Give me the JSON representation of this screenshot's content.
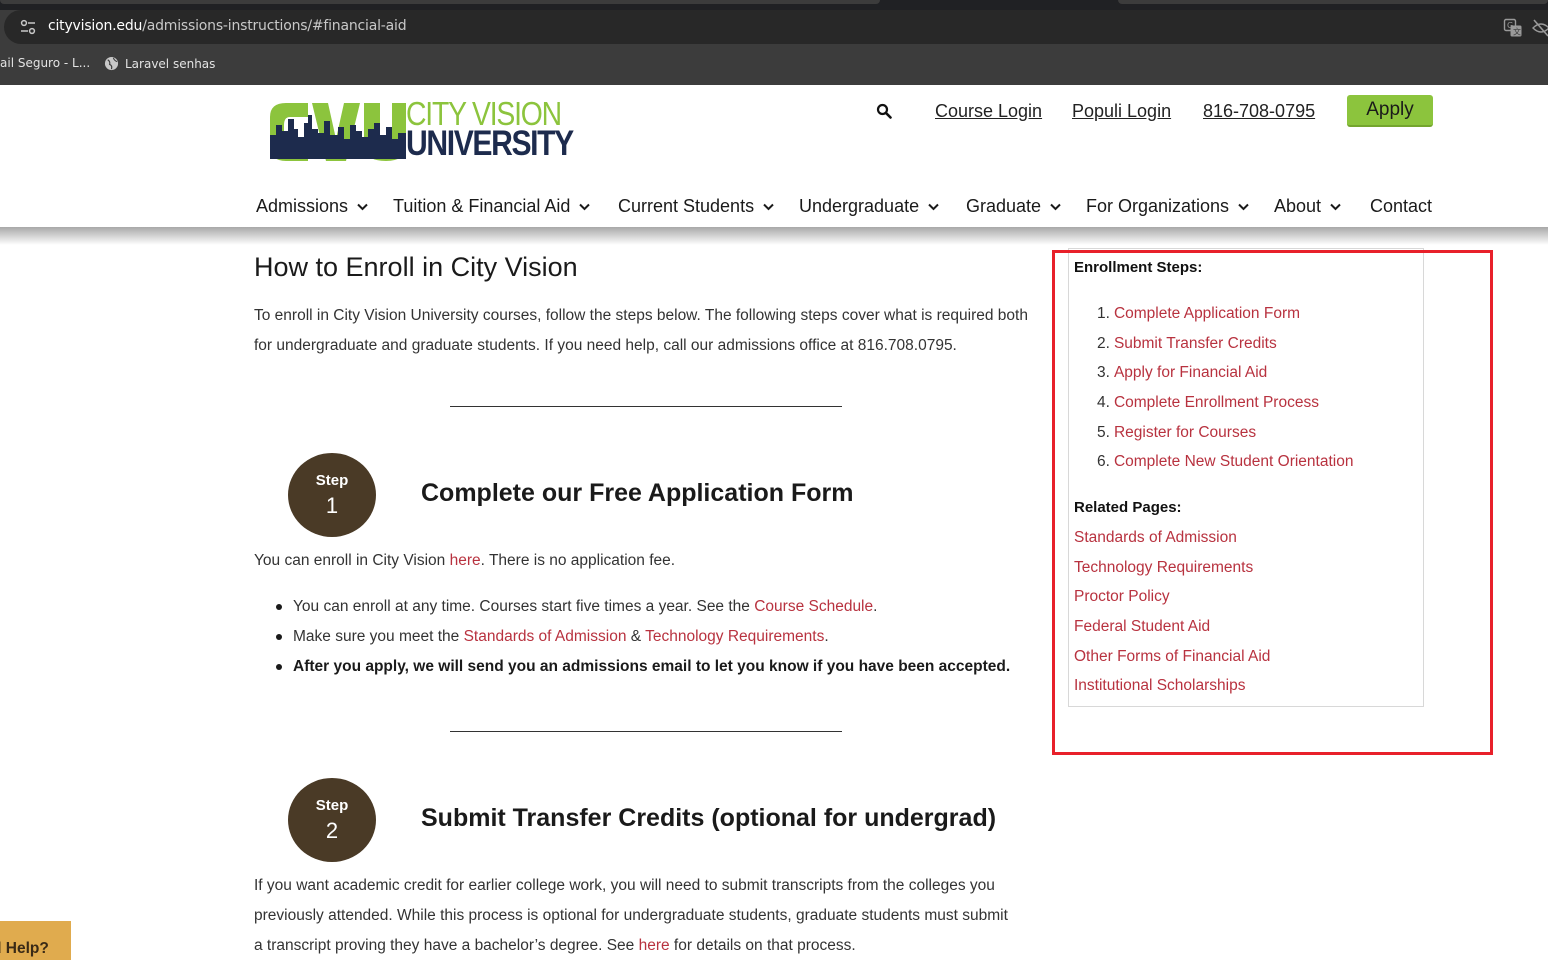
{
  "browser": {
    "url_host": "cityvision.edu",
    "url_path": "/admissions-instructions/#financial-aid",
    "bookmarks": [
      {
        "label": "ail Seguro - L..."
      },
      {
        "label": "Laravel senhas"
      }
    ]
  },
  "logo": {
    "line1": "CITY VISION",
    "line2": "UNIVERSITY",
    "brand_green": "#8cc43d",
    "brand_navy": "#1d2b4d"
  },
  "header": {
    "course_login": "Course Login",
    "populi_login": "Populi Login",
    "phone": "816-708-0795",
    "apply": "Apply"
  },
  "nav": [
    {
      "label": "Admissions",
      "has_dropdown": true
    },
    {
      "label": "Tuition & Financial Aid",
      "has_dropdown": true
    },
    {
      "label": "Current Students",
      "has_dropdown": true
    },
    {
      "label": "Undergraduate",
      "has_dropdown": true
    },
    {
      "label": "Graduate",
      "has_dropdown": true
    },
    {
      "label": "For Organizations",
      "has_dropdown": true
    },
    {
      "label": "About",
      "has_dropdown": true
    },
    {
      "label": "Contact",
      "has_dropdown": false
    }
  ],
  "main": {
    "title": "How to Enroll in City Vision",
    "intro": "To enroll in City Vision University courses, follow the steps below. The following steps cover what is required both for undergraduate and graduate students. If you need help, call our admissions office at 816.708.0795.",
    "step_word": "Step",
    "step1": {
      "number": "1",
      "heading": "Complete our Free Application Form",
      "para_before": "You can enroll in City Vision ",
      "para_link": "here",
      "para_after": ". There is no application fee.",
      "bullet1_before": "You can enroll at any time. Courses start five times a year. See the ",
      "bullet1_link": "Course Schedule",
      "bullet1_after": ".",
      "bullet2_before": "Make sure you meet the ",
      "bullet2_link1": "Standards of Admission",
      "bullet2_mid": " & ",
      "bullet2_link2": "Technology Requirements",
      "bullet2_after": ".",
      "bullet3": "After you apply, we will send you an admissions email to let you know if you have been accepted."
    },
    "step2": {
      "number": "2",
      "heading": "Submit Transfer Credits (optional for undergrad)",
      "line1": "If you want academic credit for earlier college work, you will need to submit transcripts from the colleges you",
      "line2": "previously attended. While this process is optional for undergraduate students, graduate students must submit",
      "line3_before": "a transcript proving they have a bachelor’s degree. See ",
      "line3_link": "here",
      "line3_after": " for details on that process."
    }
  },
  "sidebar": {
    "steps_heading": "Enrollment Steps:",
    "steps": [
      {
        "num": "1.",
        "label": "Complete Application Form"
      },
      {
        "num": "2.",
        "label": "Submit Transfer Credits"
      },
      {
        "num": "3.",
        "label": "Apply for Financial Aid"
      },
      {
        "num": "4.",
        "label": "Complete Enrollment Process"
      },
      {
        "num": "5.",
        "label": "Register for Courses"
      },
      {
        "num": "6.",
        "label": "Complete New Student Orientation"
      }
    ],
    "related_heading": "Related Pages:",
    "related": [
      {
        "label": "Standards of Admission"
      },
      {
        "label": "Technology Requirements"
      },
      {
        "label": "Proctor Policy"
      },
      {
        "label": "Federal Student Aid"
      },
      {
        "label": "Other Forms of Financial Aid"
      },
      {
        "label": "Institutional Scholarships"
      }
    ],
    "highlight_color": "#e8202a"
  },
  "help_tab": "d Help?",
  "colors": {
    "link": "#b8323f",
    "step_badge": "#4a3a26",
    "help_tab": "#e0ab4e"
  }
}
